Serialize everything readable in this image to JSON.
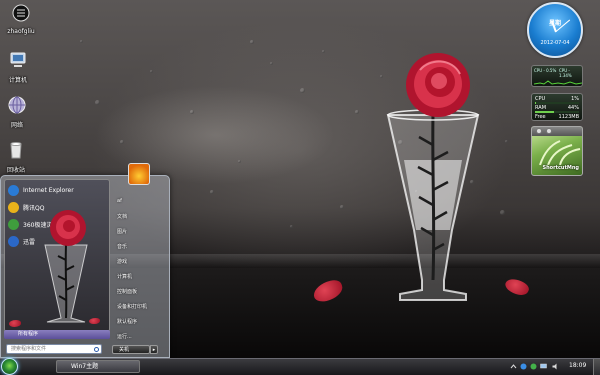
{
  "desktop": {
    "icons": [
      {
        "label": "zhaofgliu"
      },
      {
        "label": "计算机"
      },
      {
        "label": "网络"
      },
      {
        "label": "回收站"
      }
    ]
  },
  "gadgets": {
    "clock": {
      "weekday": "星期",
      "date": "2012-07-04"
    },
    "cpu_graph": {
      "cpu1": "CPU - 0.5%",
      "cpu2": "CPU - 1.34%"
    },
    "meter": {
      "cpu_label": "CPU",
      "cpu_value": "1%",
      "cpu_level": 0.01,
      "ram_label": "RAM",
      "ram_value": "44%",
      "ram_level": 0.44,
      "free_label": "Free",
      "free_value": "1123MB"
    },
    "shortcut": {
      "title": "ShortcutMng"
    }
  },
  "start_menu": {
    "pinned": [
      {
        "label": "Internet Explorer",
        "color": "#2a7bd6"
      },
      {
        "label": "腾讯QQ",
        "color": "#e9b21b"
      },
      {
        "label": "360极速浏览器",
        "color": "#3f9d3d"
      },
      {
        "label": "迅雷",
        "color": "#2b68c7"
      }
    ],
    "all_programs": "所有程序",
    "search_placeholder": "搜索程序和文件",
    "right_items": [
      {
        "label": "af"
      },
      {
        "label": "文档"
      },
      {
        "label": "图片"
      },
      {
        "label": "音乐"
      },
      {
        "label": "游戏"
      },
      {
        "label": "计算机"
      },
      {
        "label": "控制面板"
      },
      {
        "label": "设备和打印机"
      },
      {
        "label": "默认程序"
      },
      {
        "label": "运行..."
      }
    ],
    "shutdown_label": "关机",
    "shutdown_arrow": "▸"
  },
  "taskbar": {
    "task_label": "Win7主题",
    "clock": "18:09"
  }
}
